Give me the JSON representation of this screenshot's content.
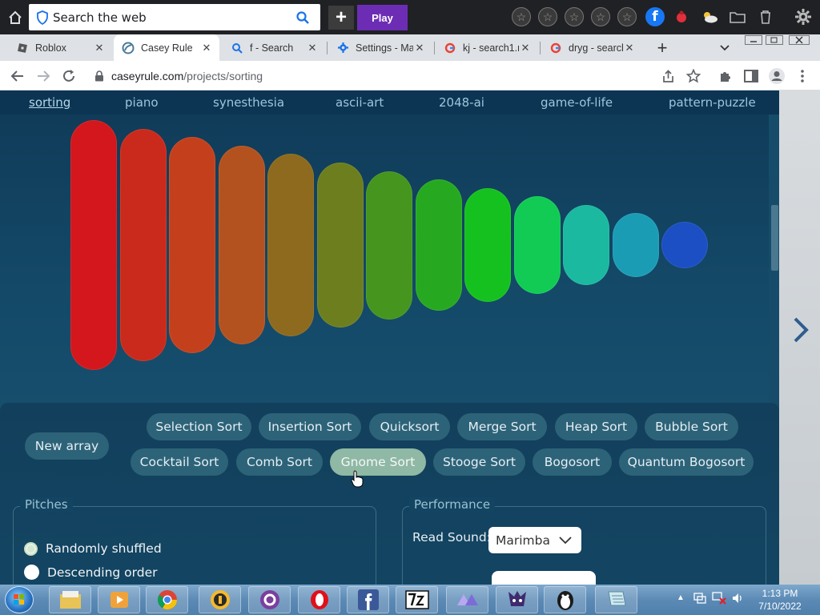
{
  "toolbar": {
    "search_placeholder": "Search the web",
    "play_label": "Play"
  },
  "tabs": [
    {
      "title": "Roblox",
      "close": "✕"
    },
    {
      "title": "Casey Rule",
      "close": "✕"
    },
    {
      "title": "f - Search",
      "close": "✕"
    },
    {
      "title": "Settings - Ma",
      "close": "✕"
    },
    {
      "title": "kj - search1.r",
      "close": "✕"
    },
    {
      "title": "dryg - search",
      "close": "✕"
    }
  ],
  "address": {
    "domain": "caseyrule.com",
    "path": "/projects/sorting"
  },
  "site_nav": [
    "sorting",
    "piano",
    "synesthesia",
    "ascii-art",
    "2048-ai",
    "game-of-life",
    "pattern-puzzle"
  ],
  "bar_colors": [
    "#d3171c",
    "#c92a1b",
    "#c4401c",
    "#b4521f",
    "#8d6a1d",
    "#6d7e1f",
    "#45951f",
    "#26a920",
    "#15c11f",
    "#11cb55",
    "#1ab9a0",
    "#1b9cb5",
    "#1b4fc3"
  ],
  "controls": {
    "new_array": "New array",
    "sort_buttons_row1": [
      "Selection Sort",
      "Insertion Sort",
      "Quicksort",
      "Merge Sort",
      "Heap Sort",
      "Bubble Sort"
    ],
    "sort_buttons_row2": [
      "Cocktail Sort",
      "Comb Sort",
      "Gnome Sort",
      "Stooge Sort",
      "Bogosort",
      "Quantum Bogosort"
    ],
    "highlighted": "Gnome Sort",
    "pitches_legend": "Pitches",
    "pitch_options": [
      {
        "label": "Randomly shuffled",
        "selected": true
      },
      {
        "label": "Descending order",
        "selected": false
      }
    ],
    "performance_legend": "Performance",
    "read_sound_label": "Read Sound:",
    "read_sound_value": "Marimba"
  },
  "taskbar": {
    "time": "1:13 PM",
    "date": "7/10/2022"
  }
}
